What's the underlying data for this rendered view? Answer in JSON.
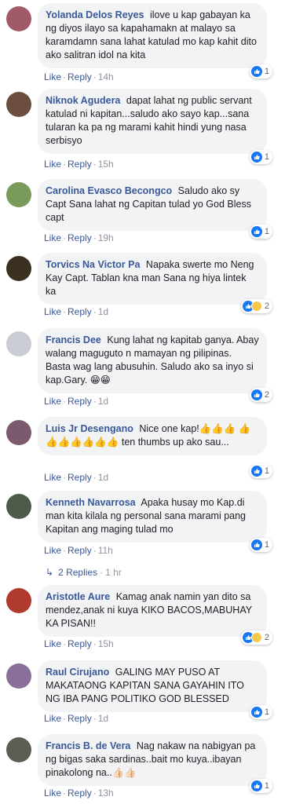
{
  "comments": [
    {
      "author": "Yolanda Delos Reyes",
      "text": "ilove u kap gabayan ka ng diyos ilayo sa kapahamakn at malayo sa karamdamn sana lahat katulad mo kap kahit dito ako salitran idol na kita",
      "like": "Like",
      "reply": "Reply",
      "time": "14h",
      "reactions": "1",
      "reaction_types": [
        "like"
      ],
      "avatar_color": "#a05a6a"
    },
    {
      "author": "Niknok Agudera",
      "text": "dapat lahat ng public servant katulad ni kapitan...saludo ako sayo kap...sana tularan ka pa ng marami kahit hindi yung nasa serbisyo",
      "like": "Like",
      "reply": "Reply",
      "time": "15h",
      "reactions": "1",
      "reaction_types": [
        "like"
      ],
      "avatar_color": "#6b4e3d"
    },
    {
      "author": "Carolina Evasco Becongco",
      "text": "Saludo ako sy Capt Sana lahat ng Capitan tulad yo God Bless capt",
      "like": "Like",
      "reply": "Reply",
      "time": "19h",
      "reactions": "1",
      "reaction_types": [
        "like"
      ],
      "avatar_color": "#7a9a5a"
    },
    {
      "author": "Torvics Na Victor Pa",
      "text": "Napaka swerte mo Neng Kay Capt. Tablan kna man Sana ng hiya lintek ka",
      "like": "Like",
      "reply": "Reply",
      "time": "1d",
      "reactions": "2",
      "reaction_types": [
        "like",
        "haha"
      ],
      "avatar_color": "#3a3020"
    },
    {
      "author": "Francis Dee",
      "text": "Kung lahat ng kapitab ganya. Abay walang maguguto n mamayan ng pilipinas. Basta wag lang abusuhin. Saludo ako sa inyo si kap.Gary. 😁😁",
      "like": "Like",
      "reply": "Reply",
      "time": "1d",
      "reactions": "2",
      "reaction_types": [
        "like"
      ],
      "avatar_color": "#c9ccd2"
    },
    {
      "author": "Luis Jr Desengano",
      "text": "Nice one kap!👍👍👍 👍👍👍👍👍👍👍 ten thumbs up ako sau...",
      "like": "Like",
      "reply": "Reply",
      "time": "1d",
      "reactions": "1",
      "reaction_types": [
        "like"
      ],
      "avatar_color": "#7b5a6e"
    },
    {
      "author": "Kenneth Navarrosa",
      "text": "Apaka husay mo Kap.di man kita kilala ng personal sana marami pang Kapitan ang maging tulad mo",
      "like": "Like",
      "reply": "Reply",
      "time": "11h",
      "reactions": "1",
      "reaction_types": [
        "like"
      ],
      "avatar_color": "#4e5a4a",
      "replies_label": "2 Replies",
      "replies_time": "1 hr"
    },
    {
      "author": "Aristotle Aure",
      "text": "Kamag anak namin yan dito sa mendez,anak ni kuya KIKO BACOS,MABUHAY KA PISAN!!",
      "like": "Like",
      "reply": "Reply",
      "time": "15h",
      "reactions": "2",
      "reaction_types": [
        "like",
        "wow"
      ],
      "avatar_color": "#b03a2e"
    },
    {
      "author": "Raul Cirujano",
      "text": "GALING MAY PUSO AT MAKATAONG KAPITAN SANA GAYAHIN ITO NG IBA PANG POLITIKO GOD BLESSED",
      "like": "Like",
      "reply": "Reply",
      "time": "1d",
      "reactions": "1",
      "reaction_types": [
        "like"
      ],
      "avatar_color": "#8a6f9a"
    },
    {
      "author": "Francis B. de Vera",
      "text": "Nag nakaw na nabigyan pa ng bigas saka sardinas..bait mo kuya..ibayan pinakolong na..👍🏻👍🏻",
      "like": "Like",
      "reply": "Reply",
      "time": "13h",
      "reactions": "1",
      "reaction_types": [
        "like"
      ],
      "avatar_color": "#5b5e55"
    }
  ],
  "colors": {
    "link": "#385898",
    "bubble": "#f2f3f5",
    "like_blue": "#1877f2",
    "muted": "#90949c"
  },
  "separator": "·",
  "icons": {
    "like": "thumbs-up-icon",
    "haha": "haha-icon",
    "wow": "wow-icon",
    "reply_arrow": "reply-arrow-icon"
  }
}
